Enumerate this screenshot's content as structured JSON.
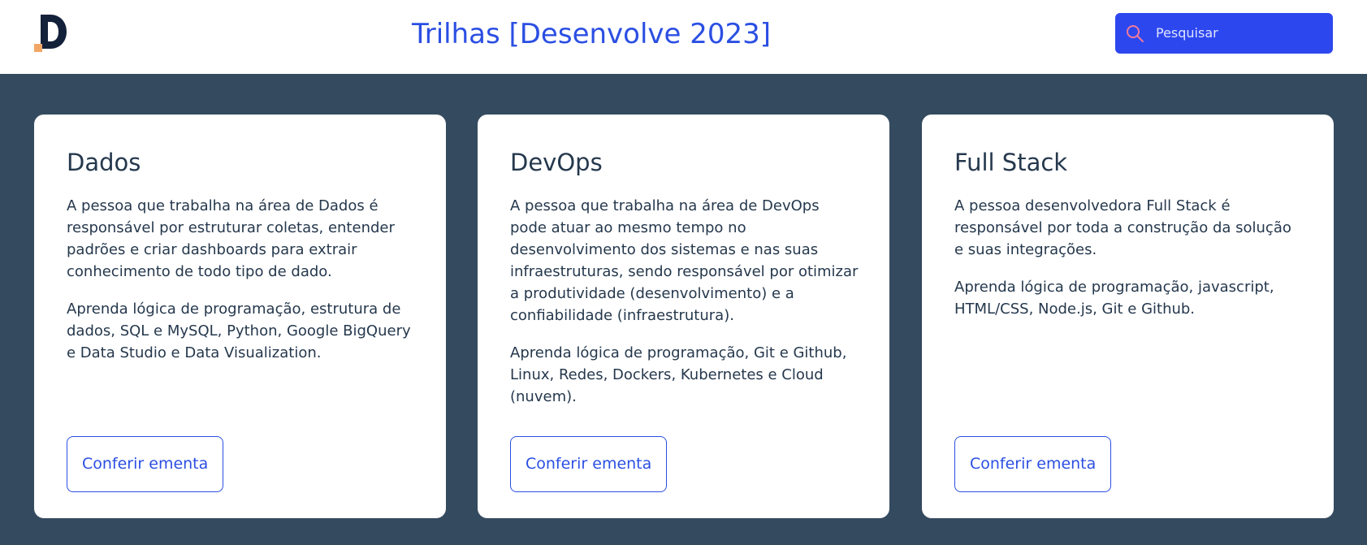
{
  "header": {
    "logo_icon": "d-logo-icon",
    "title": "Trilhas [Desenvolve 2023]",
    "search": {
      "placeholder": "Pesquisar",
      "icon": "search-icon"
    }
  },
  "colors": {
    "background": "#344a5f",
    "accent": "#2b4fe3",
    "search_bg": "#2d47ef",
    "logo_dark": "#14213a",
    "logo_accent": "#f2a766"
  },
  "cards": [
    {
      "title": "Dados",
      "description": "A pessoa que trabalha na área de Dados é responsável por estruturar coletas, entender padrões e criar dashboards para extrair conhecimento de todo tipo de dado.",
      "topics": "Aprenda lógica de programação, estrutura de dados, SQL e MySQL, Python, Google BigQuery e Data Studio e Data Visualization.",
      "button": "Conferir ementa"
    },
    {
      "title": "DevOps",
      "description": "A pessoa que trabalha na área de DevOps pode atuar ao mesmo tempo no desenvolvimento dos sistemas e nas suas infraestruturas, sendo responsável por otimizar a produtividade (desenvolvimento) e a confiabilidade (infraestrutura).",
      "topics": "Aprenda lógica de programação, Git e Github, Linux, Redes, Dockers, Kubernetes e Cloud (nuvem).",
      "button": "Conferir ementa"
    },
    {
      "title": "Full Stack",
      "description": "A pessoa desenvolvedora Full Stack é responsável por toda a construção da solução e suas integrações.",
      "topics": "Aprenda lógica de programação, javascript, HTML/CSS, Node.js, Git e Github.",
      "button": "Conferir ementa"
    }
  ]
}
